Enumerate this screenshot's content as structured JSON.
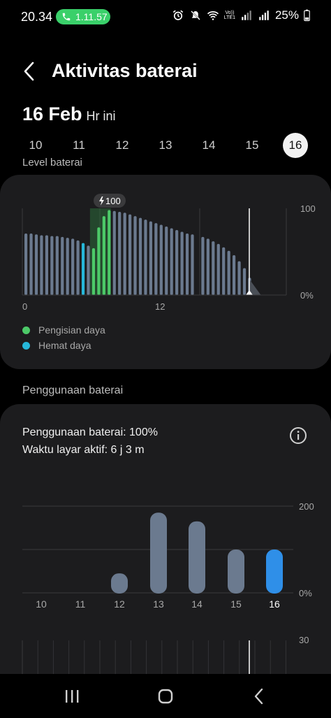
{
  "status_bar": {
    "time": "20.34",
    "call_duration": "1.11.57",
    "volte_label": "Vo))\nLTE1",
    "battery_percent": "25%",
    "icons": [
      "alarm-icon",
      "mute-icon",
      "wifi-icon",
      "volte-icon",
      "signal-icon",
      "signal-icon",
      "battery-icon"
    ]
  },
  "header": {
    "title": "Aktivitas baterai",
    "back_icon": "chevron-left-icon"
  },
  "date": {
    "main": "16 Feb",
    "sub": "Hr ini"
  },
  "day_tabs": [
    {
      "label": "10",
      "active": false
    },
    {
      "label": "11",
      "active": false
    },
    {
      "label": "12",
      "active": false
    },
    {
      "label": "13",
      "active": false
    },
    {
      "label": "14",
      "active": false
    },
    {
      "label": "15",
      "active": false
    },
    {
      "label": "16",
      "active": true
    }
  ],
  "level_section_title": "Level baterai",
  "battery_level_chart": {
    "type": "bar",
    "charge_badge": "100",
    "y_ticks": [
      "100",
      "0%"
    ],
    "x_ticks": [
      "0",
      "12"
    ],
    "colors": {
      "normal": "#6b7a8f",
      "charging": "#4cc968",
      "power_saving": "#26b7d9"
    }
  },
  "legend": [
    {
      "label": "Pengisian daya",
      "color": "#4cc968"
    },
    {
      "label": "Hemat daya",
      "color": "#26b7d9"
    }
  ],
  "usage_section_title": "Penggunaan baterai",
  "usage_info": {
    "usage_line": "Penggunaan baterai: 100%",
    "screen_time_line": "Waktu layar aktif: 6 j 3 m",
    "info_icon": "info-icon"
  },
  "chart_data": [
    {
      "type": "bar",
      "title": "Level baterai",
      "x": [
        0,
        1,
        2,
        3,
        4,
        5,
        6,
        7,
        8,
        9,
        10,
        11,
        12,
        13,
        14,
        15,
        16,
        17,
        18,
        19,
        20,
        21,
        22,
        23,
        24,
        25,
        26,
        27,
        28,
        29,
        30,
        31,
        32,
        33,
        34,
        35,
        36,
        37,
        38,
        39,
        40,
        41,
        42,
        43
      ],
      "values": [
        71,
        71,
        70,
        69,
        69,
        68,
        68,
        67,
        66,
        65,
        63,
        60,
        57,
        54,
        78,
        91,
        98,
        97,
        96,
        95,
        93,
        91,
        89,
        87,
        85,
        83,
        81,
        79,
        77,
        75,
        73,
        71,
        70,
        -1,
        67,
        65,
        62,
        59,
        55,
        51,
        46,
        39,
        31,
        20
      ],
      "state": [
        "n",
        "n",
        "n",
        "n",
        "n",
        "n",
        "n",
        "n",
        "n",
        "n",
        "n",
        "s",
        "n",
        "c",
        "c",
        "c",
        "c",
        "n",
        "n",
        "n",
        "n",
        "n",
        "n",
        "n",
        "n",
        "n",
        "n",
        "n",
        "n",
        "n",
        "n",
        "n",
        "n",
        "gap",
        "n",
        "n",
        "n",
        "n",
        "n",
        "n",
        "n",
        "n",
        "n",
        "n"
      ],
      "x_ticks": [
        "0",
        "12"
      ],
      "y_ticks": [
        "100",
        "0%"
      ],
      "ylim": [
        0,
        100
      ],
      "charge_annotation": "100",
      "series": [
        {
          "name": "Pengisian daya",
          "color": "#4cc968"
        },
        {
          "name": "Hemat daya",
          "color": "#26b7d9"
        }
      ]
    },
    {
      "type": "bar",
      "title": "Penggunaan baterai",
      "categories": [
        "10",
        "11",
        "12",
        "13",
        "14",
        "15",
        "16"
      ],
      "values": [
        0,
        0,
        45,
        185,
        165,
        100,
        100
      ],
      "highlight_index": 6,
      "y_ticks": [
        "200",
        "0%"
      ],
      "ylim": [
        0,
        200
      ],
      "colors": {
        "normal": "#6b7a8f",
        "highlight": "#2f8fe8"
      }
    }
  ],
  "screen_time_peek": {
    "y_tick": "30"
  },
  "nav_bar": {
    "recents_icon": "recents-icon",
    "home_icon": "home-icon",
    "back_icon": "back-icon"
  }
}
